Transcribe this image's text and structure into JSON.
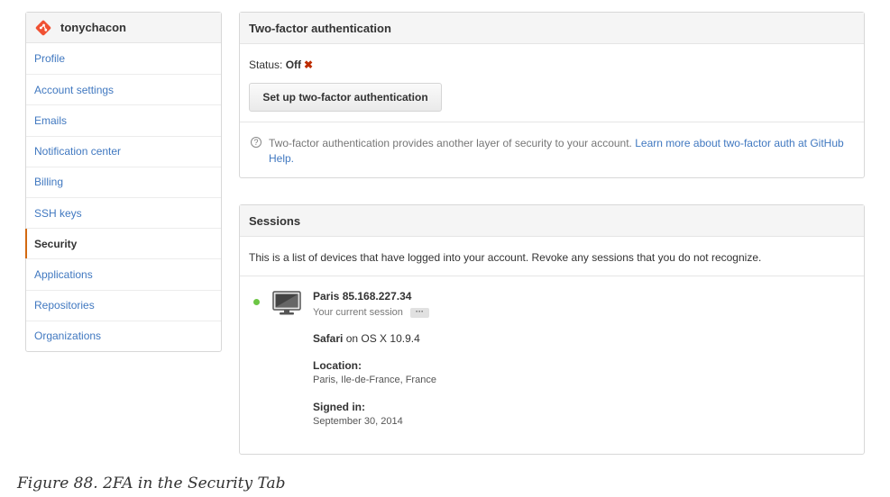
{
  "sidebar": {
    "username": "tonychacon",
    "logo_icon": "git-logo-icon",
    "items": [
      {
        "label": "Profile",
        "selected": false
      },
      {
        "label": "Account settings",
        "selected": false
      },
      {
        "label": "Emails",
        "selected": false
      },
      {
        "label": "Notification center",
        "selected": false
      },
      {
        "label": "Billing",
        "selected": false
      },
      {
        "label": "SSH keys",
        "selected": false
      },
      {
        "label": "Security",
        "selected": true
      },
      {
        "label": "Applications",
        "selected": false
      },
      {
        "label": "Repositories",
        "selected": false
      },
      {
        "label": "Organizations",
        "selected": false
      }
    ]
  },
  "two_factor": {
    "title": "Two-factor authentication",
    "status_label": "Status:",
    "status_value": "Off",
    "status_mark": "✖",
    "setup_button": "Set up two-factor authentication",
    "help_icon": "question-circle-icon",
    "help_text": "Two-factor authentication provides another layer of security to your account.",
    "help_link": "Learn more about two-factor auth at GitHub Help."
  },
  "sessions": {
    "title": "Sessions",
    "description": "This is a list of devices that have logged into your account. Revoke any sessions that you do not recognize.",
    "device_icon": "monitor-icon",
    "session": {
      "location_ip": "Paris 85.168.227.34",
      "current_label": "Your current session",
      "more_button": "···",
      "browser": "Safari",
      "os_text": "on OS X 10.9.4",
      "location_label": "Location:",
      "location_value": "Paris, Ile-de-France, France",
      "signed_in_label": "Signed in:",
      "signed_in_value": "September 30, 2014"
    }
  },
  "caption": "Figure 88. 2FA in the Security Tab",
  "colors": {
    "link": "#4078c0",
    "selected_accent": "#d26911",
    "status_off": "#bd2c00",
    "online_dot": "#6cc644",
    "logo": "#f05133"
  }
}
